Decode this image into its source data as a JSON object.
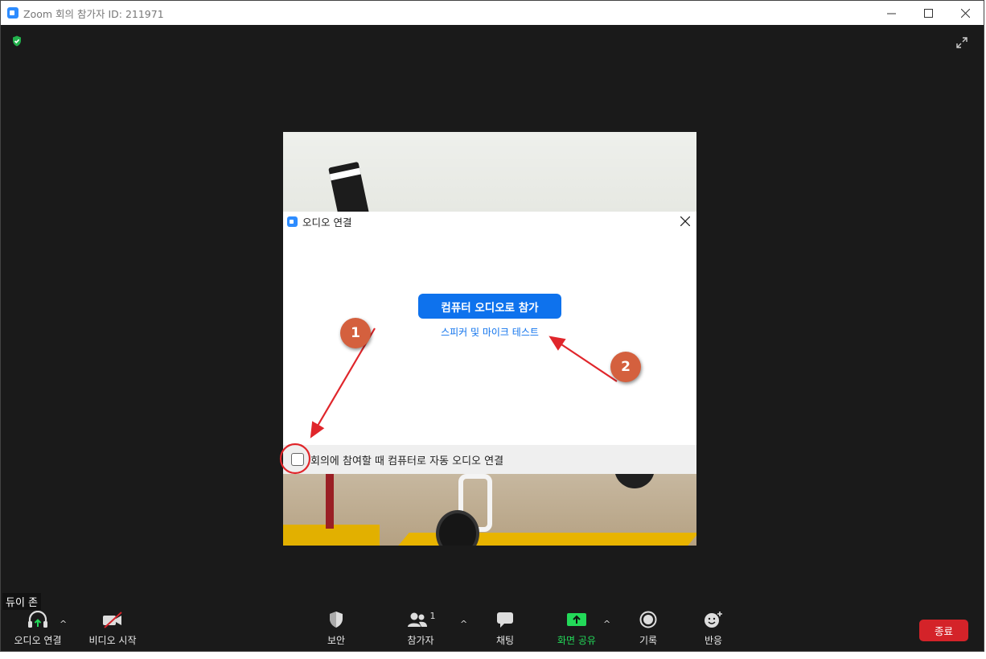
{
  "window": {
    "title": "Zoom 회의 참가자 ID: 211971",
    "minimize_icon": "minimize-icon",
    "maximize_icon": "maximize-icon",
    "close_icon": "close-icon"
  },
  "meeting": {
    "participant_name": "듀이 존"
  },
  "dialog": {
    "title": "오디오 연결",
    "join_button": "컴퓨터 오디오로 참가",
    "test_link": "스피커 및 마이크 테스트",
    "auto_connect_label": "회의에 참여할 때 컴퓨터로 자동 오디오 연결",
    "auto_connect_checked": false
  },
  "annotations": {
    "badge1": "1",
    "badge2": "2",
    "color": "#e0262b",
    "badge_color": "#d4603e"
  },
  "toolbar": {
    "audio": "오디오 연결",
    "video": "비디오 시작",
    "security": "보안",
    "participants": "참가자",
    "participants_count": "1",
    "chat": "채팅",
    "share": "화면 공유",
    "record": "기록",
    "reactions": "반응",
    "end": "종료",
    "share_color": "#23d959",
    "end_color": "#d42329"
  }
}
